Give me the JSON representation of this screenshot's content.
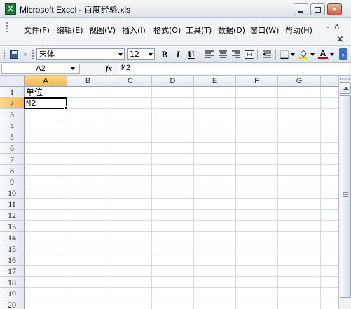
{
  "window": {
    "title": "Microsoft Excel - 百度经验.xls",
    "app_icon_glyph": "X",
    "controls": {
      "minimize": "minimize-icon",
      "maximize": "maximize-icon",
      "close": "close-icon"
    }
  },
  "menu": {
    "items": [
      "文件(F)",
      "编辑(E)",
      "视图(V)",
      "插入(I)",
      "格式(O)",
      "工具(T)",
      "数据(D)",
      "窗口(W)",
      "帮助(H)"
    ],
    "mdi_restore": "-  ð",
    "mdi_close": "×"
  },
  "toolbar": {
    "font_name": "宋体",
    "font_size": "12",
    "bold": "B",
    "italic": "I",
    "underline": "U",
    "font_color_label": "A",
    "font_color": "#d00000",
    "fill_color": "#ffd200"
  },
  "formula_bar": {
    "name_box": "A2",
    "fx_label": "fx",
    "content": "M2"
  },
  "sheet": {
    "columns": [
      "A",
      "B",
      "C",
      "D",
      "E",
      "F",
      "G"
    ],
    "rows": [
      "1",
      "2",
      "3",
      "4",
      "5",
      "6",
      "7",
      "8",
      "9",
      "10",
      "11",
      "12",
      "13",
      "14",
      "15",
      "16",
      "17",
      "18",
      "19",
      "20"
    ],
    "active_cell": "A2",
    "cells": {
      "A1": "单位",
      "A2": "M2"
    }
  }
}
